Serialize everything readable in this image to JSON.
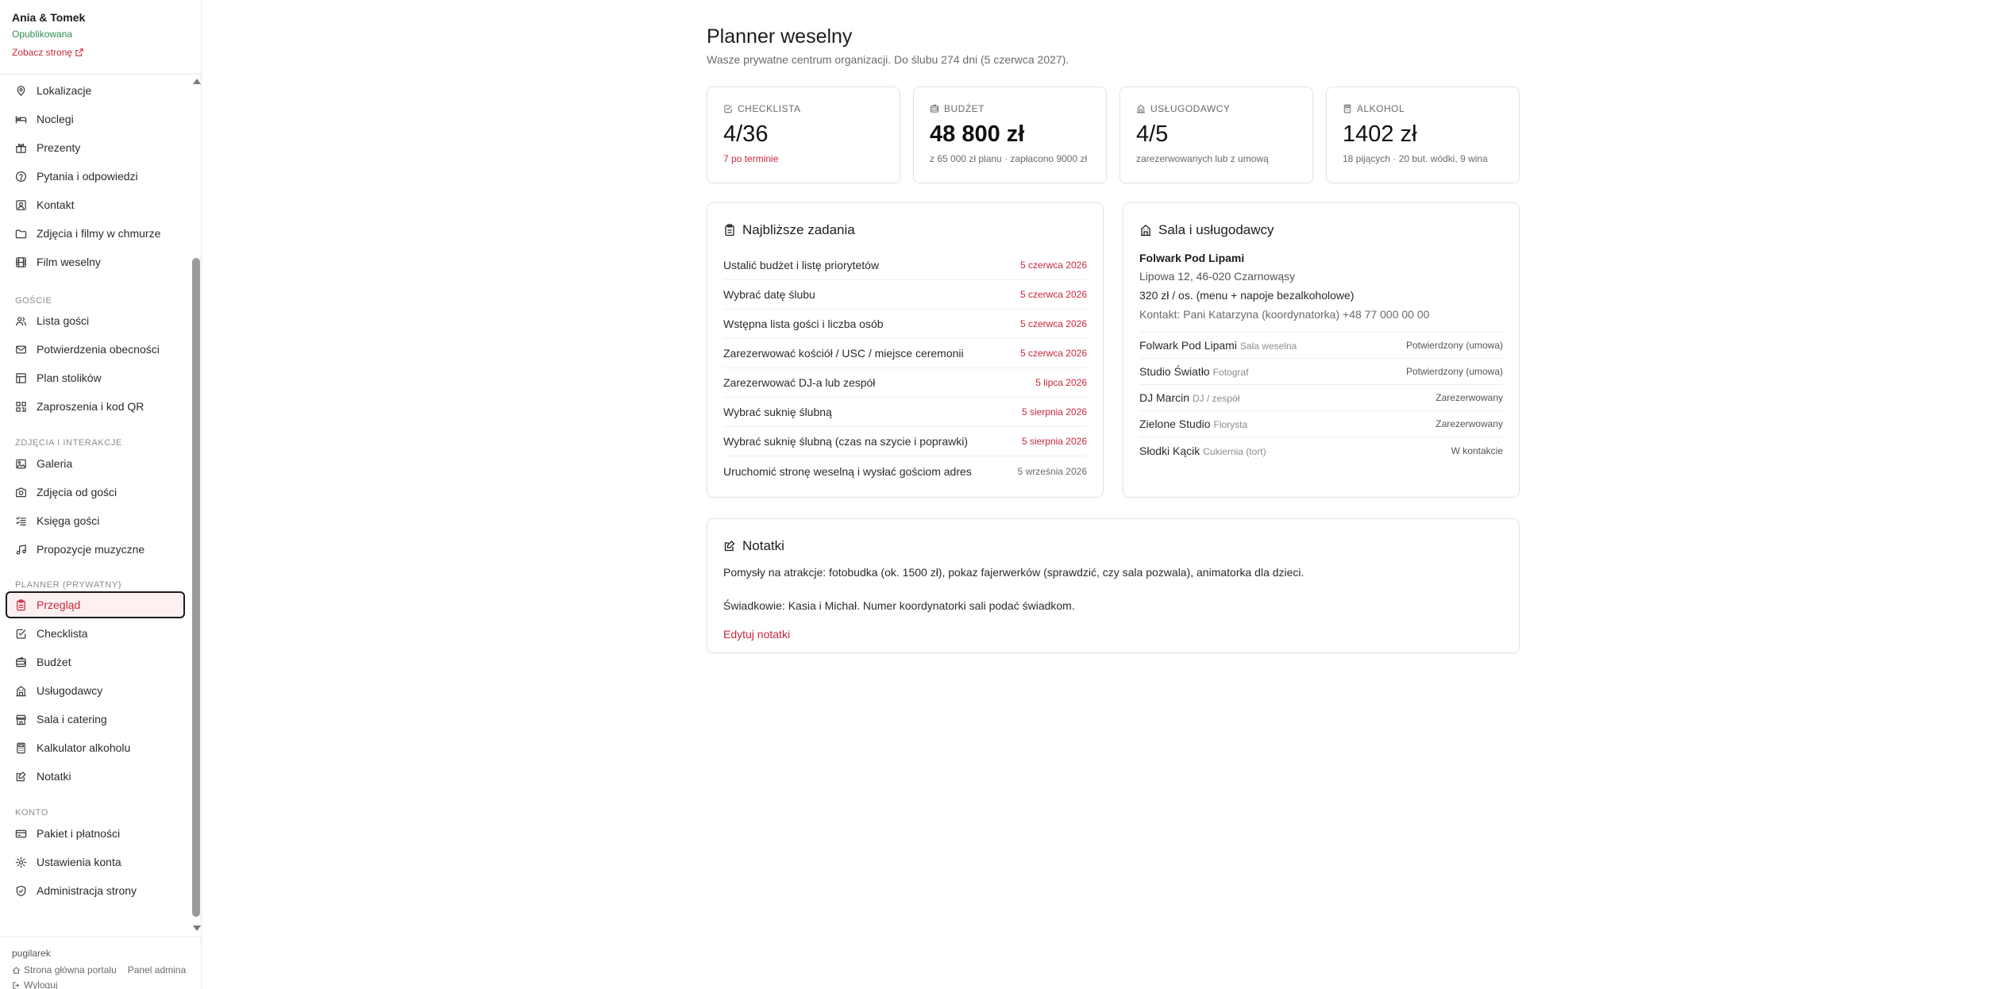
{
  "site": {
    "name": "Ania & Tomek",
    "status": "Opublikowana",
    "view_link": "Zobacz stronę"
  },
  "nav": {
    "items_top": [
      {
        "label": "Lokalizacje",
        "icon": "map-pin-icon"
      },
      {
        "label": "Noclegi",
        "icon": "bed-icon"
      },
      {
        "label": "Prezenty",
        "icon": "gift-icon"
      },
      {
        "label": "Pytania i odpowiedzi",
        "icon": "help-circle-icon"
      },
      {
        "label": "Kontakt",
        "icon": "contact-icon"
      },
      {
        "label": "Zdjęcia i filmy w chmurze",
        "icon": "folder-icon"
      },
      {
        "label": "Film weselny",
        "icon": "film-icon"
      }
    ],
    "sections": [
      {
        "title": "GOŚCIE",
        "items": [
          {
            "label": "Lista gości",
            "icon": "users-icon"
          },
          {
            "label": "Potwierdzenia obecności",
            "icon": "mail-icon"
          },
          {
            "label": "Plan stolików",
            "icon": "layout-icon"
          },
          {
            "label": "Zaproszenia i kod QR",
            "icon": "qr-code-icon"
          }
        ]
      },
      {
        "title": "ZDJĘCIA I INTERAKCJE",
        "items": [
          {
            "label": "Galeria",
            "icon": "image-icon"
          },
          {
            "label": "Zdjęcia od gości",
            "icon": "camera-icon"
          },
          {
            "label": "Księga gości",
            "icon": "list-check-icon"
          },
          {
            "label": "Propozycje muzyczne",
            "icon": "music-icon"
          }
        ]
      },
      {
        "title": "PLANNER (PRYWATNY)",
        "items": [
          {
            "label": "Przegląd",
            "icon": "clipboard-icon",
            "active": true
          },
          {
            "label": "Checklista",
            "icon": "check-square-icon"
          },
          {
            "label": "Budżet",
            "icon": "wallet-icon"
          },
          {
            "label": "Usługodawcy",
            "icon": "building-icon"
          },
          {
            "label": "Sala i catering",
            "icon": "store-icon"
          },
          {
            "label": "Kalkulator alkoholu",
            "icon": "calculator-icon"
          },
          {
            "label": "Notatki",
            "icon": "notepad-icon"
          }
        ]
      },
      {
        "title": "KONTO",
        "items": [
          {
            "label": "Pakiet i płatności",
            "icon": "credit-card-icon"
          },
          {
            "label": "Ustawienia konta",
            "icon": "gear-icon"
          },
          {
            "label": "Administracja strony",
            "icon": "shield-icon"
          }
        ]
      }
    ]
  },
  "footer": {
    "user": "pugilarek",
    "portal_link": "Strona główna portalu",
    "admin_link": "Panel admina",
    "logout": "Wyloguj"
  },
  "header": {
    "title": "Planner weselny",
    "subtitle": "Wasze prywatne centrum organizacji. Do ślubu 274 dni (5 czerwca 2027)."
  },
  "stats": [
    {
      "label": "CHECKLISTA",
      "value": "4/36",
      "sub": "7 po terminie",
      "icon": "check-square-icon",
      "sub_red": true
    },
    {
      "label": "BUDŻET",
      "value": "48 800 zł",
      "sub": "z 65 000 zł planu · zapłacono 9000 zł",
      "icon": "wallet-icon",
      "sub_red": false
    },
    {
      "label": "USŁUGODAWCY",
      "value": "4/5",
      "sub": "zarezerwowanych lub z umową",
      "icon": "building-icon",
      "sub_red": false
    },
    {
      "label": "ALKOHOL",
      "value": "1402 zł",
      "sub": "18 pijących · 20 but. wódki, 9 wina",
      "icon": "calculator-icon",
      "sub_red": false
    }
  ],
  "tasks": {
    "title": "Najbliższe zadania",
    "items": [
      {
        "name": "Ustalić budżet i listę priorytetów",
        "date": "5 czerwca 2026",
        "overdue": true
      },
      {
        "name": "Wybrać datę ślubu",
        "date": "5 czerwca 2026",
        "overdue": true
      },
      {
        "name": "Wstępna lista gości i liczba osób",
        "date": "5 czerwca 2026",
        "overdue": true
      },
      {
        "name": "Zarezerwować kościół / USC / miejsce ceremonii",
        "date": "5 czerwca 2026",
        "overdue": true
      },
      {
        "name": "Zarezerwować DJ-a lub zespół",
        "date": "5 lipca 2026",
        "overdue": true
      },
      {
        "name": "Wybrać suknię ślubną",
        "date": "5 sierpnia 2026",
        "overdue": true
      },
      {
        "name": "Wybrać suknię ślubną (czas na szycie i poprawki)",
        "date": "5 sierpnia 2026",
        "overdue": true
      },
      {
        "name": "Uruchomić stronę weselną i wysłać gościom adres",
        "date": "5 września 2026",
        "overdue": false
      }
    ]
  },
  "venue": {
    "title": "Sala i usługodawcy",
    "name": "Folwark Pod Lipami",
    "address": "Lipowa 12, 46-020 Czarnowąsy",
    "price": "320 zł / os. (menu + napoje bezalkoholowe)",
    "contact": "Kontakt: Pani Katarzyna (koordynatorka) +48 77 000 00 00",
    "vendors": [
      {
        "name": "Folwark Pod Lipami",
        "category": "Sala weselna",
        "status": "Potwierdzony (umowa)"
      },
      {
        "name": "Studio Światło",
        "category": "Fotograf",
        "status": "Potwierdzony (umowa)"
      },
      {
        "name": "DJ Marcin",
        "category": "DJ / zespół",
        "status": "Zarezerwowany"
      },
      {
        "name": "Zielone Studio",
        "category": "Florysta",
        "status": "Zarezerwowany"
      },
      {
        "name": "Słodki Kącik",
        "category": "Cukiernia (tort)",
        "status": "W kontakcie"
      }
    ]
  },
  "notes": {
    "title": "Notatki",
    "lines": [
      "Pomysły na atrakcje: fotobudka (ok. 1500 zł), pokaz fajerwerków (sprawdzić, czy sala pozwala), animatorka dla dzieci.",
      "Świadkowie: Kasia i Michał. Numer koordynatorki sali podać świadkom."
    ],
    "edit_link": "Edytuj notatki"
  },
  "colors": {
    "accent": "#c8283c",
    "published": "#2f8f53",
    "active_bg": "#fdf0f1"
  }
}
